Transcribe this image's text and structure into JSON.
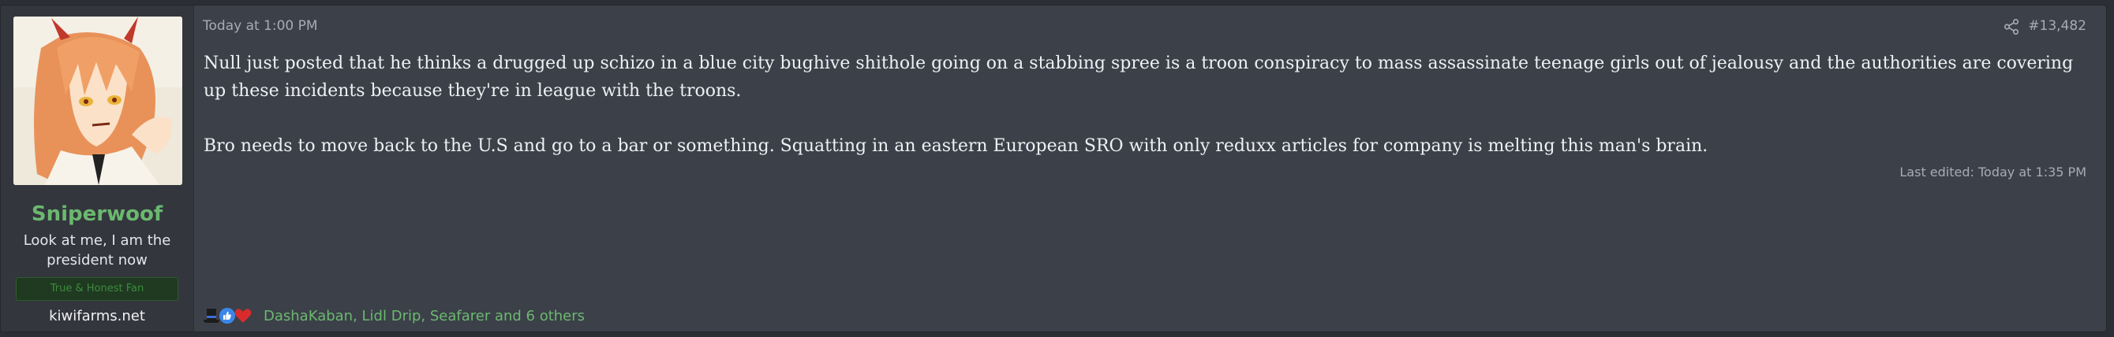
{
  "user": {
    "username": "Sniperwoof",
    "title": "Look at me, I am the president now",
    "banner": "True & Honest Fan",
    "site": "kiwifarms.net",
    "avatar_icon": "anime-avatar-image"
  },
  "post": {
    "date": "Today at 1:00 PM",
    "number": "#13,482",
    "share_icon": "share-icon",
    "paragraphs": [
      "Null just posted that he thinks a drugged up schizo in a blue city bughive shithole going on a stabbing spree is a troon conspiracy to mass assassinate teenage girls out of jealousy and the authorities are covering up these incidents because they're in league with the troons.",
      "Bro needs to move back to the U.S and go to a bar or something. Squatting in an eastern European SRO with only reduxx articles for company is melting this man's brain."
    ],
    "last_edited": "Last edited: Today at 1:35 PM"
  },
  "reactions": {
    "icons": [
      "top-hat-icon",
      "thumbs-up-icon",
      "heart-icon"
    ],
    "users_text": "DashaKaban, Lidl Drip, Seafarer and 6 others"
  },
  "colors": {
    "username": "#6bb86f",
    "background": "#3c4049",
    "sidebar": "#33363d",
    "text": "#eef0f3",
    "muted": "#a7abb3"
  }
}
